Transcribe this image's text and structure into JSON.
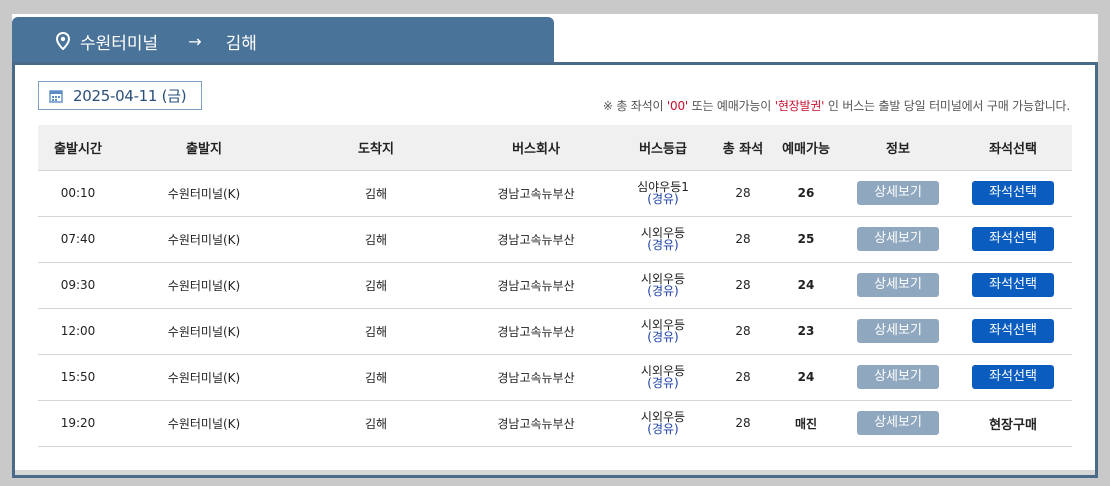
{
  "route": {
    "origin": "수원터미널",
    "arrow": "→",
    "destination": "김해"
  },
  "date": {
    "label": "2025-04-11 (금)"
  },
  "notice": {
    "prefix": "※ 총 좌석이 ",
    "q1": "'00'",
    "mid": " 또는 예매가능이 ",
    "q2": "'현장발권'",
    "suffix": " 인 버스는 출발 당일 터미널에서 구매 가능합니다."
  },
  "table": {
    "headers": [
      "출발시간",
      "출발지",
      "도착지",
      "버스회사",
      "버스등급",
      "총 좌석",
      "예매가능",
      "정보",
      "좌석선택"
    ],
    "rows": [
      {
        "time": "00:10",
        "origin": "수원터미널(K)",
        "dest": "김해",
        "company": "경남고속뉴부산",
        "grade": "심야우등1",
        "via": "(경유)",
        "total": "28",
        "avail": "26",
        "detail": "상세보기",
        "seat": "좌석선택"
      },
      {
        "time": "07:40",
        "origin": "수원터미널(K)",
        "dest": "김해",
        "company": "경남고속뉴부산",
        "grade": "시외우등",
        "via": "(경유)",
        "total": "28",
        "avail": "25",
        "detail": "상세보기",
        "seat": "좌석선택"
      },
      {
        "time": "09:30",
        "origin": "수원터미널(K)",
        "dest": "김해",
        "company": "경남고속뉴부산",
        "grade": "시외우등",
        "via": "(경유)",
        "total": "28",
        "avail": "24",
        "detail": "상세보기",
        "seat": "좌석선택"
      },
      {
        "time": "12:00",
        "origin": "수원터미널(K)",
        "dest": "김해",
        "company": "경남고속뉴부산",
        "grade": "시외우등",
        "via": "(경유)",
        "total": "28",
        "avail": "23",
        "detail": "상세보기",
        "seat": "좌석선택"
      },
      {
        "time": "15:50",
        "origin": "수원터미널(K)",
        "dest": "김해",
        "company": "경남고속뉴부산",
        "grade": "시외우등",
        "via": "(경유)",
        "total": "28",
        "avail": "24",
        "detail": "상세보기",
        "seat": "좌석선택"
      },
      {
        "time": "19:20",
        "origin": "수원터미널(K)",
        "dest": "김해",
        "company": "경남고속뉴부산",
        "grade": "시외우등",
        "via": "(경유)",
        "total": "28",
        "avail": "매진",
        "detail": "상세보기",
        "seat": "현장구매"
      }
    ]
  },
  "colors": {
    "tab": "#4a7399",
    "detail_button": "#8fa8c0",
    "seat_button": "#0a5cbf",
    "notice_red": "#c8102e",
    "via_blue": "#1a3fa6"
  },
  "icons": {
    "route": "location-pin-icon",
    "date": "calendar-icon"
  }
}
